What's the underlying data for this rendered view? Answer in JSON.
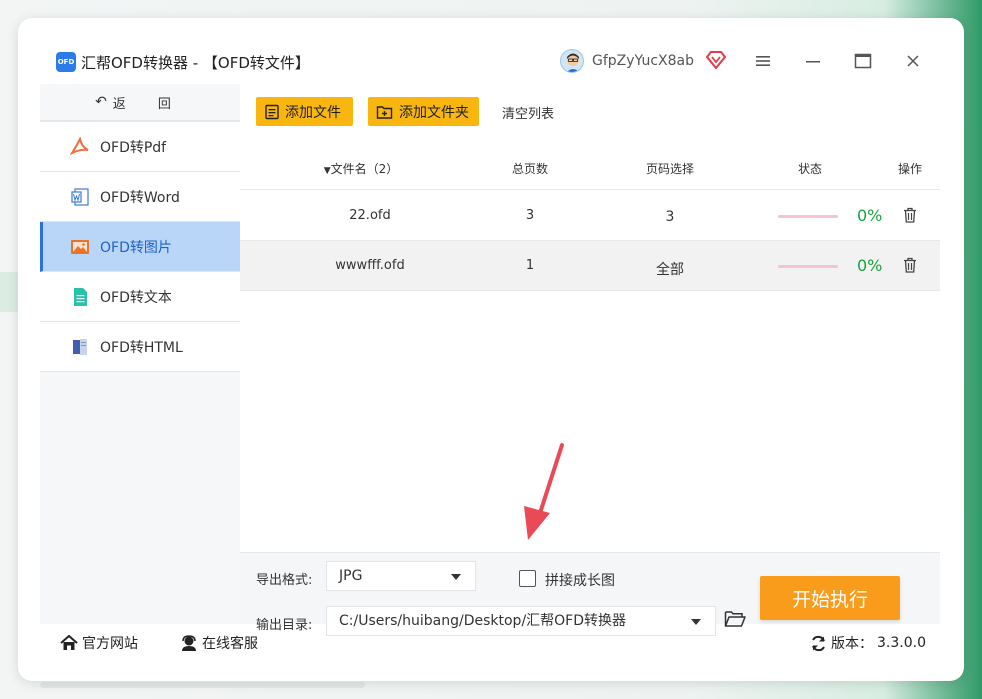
{
  "titlebar": {
    "logo_text": "OFD",
    "title": "汇帮OFD转换器 - 【OFD转文件】",
    "username": "GfpZyYucX8ab"
  },
  "sidebar": {
    "back_label": "返 回",
    "items": [
      {
        "label": "OFD转Pdf",
        "icon": "pdf-icon",
        "color": "#f0703e"
      },
      {
        "label": "OFD转Word",
        "icon": "word-icon",
        "color": "#3b78d8"
      },
      {
        "label": "OFD转图片",
        "icon": "image-icon",
        "color": "#e8742b",
        "active": true
      },
      {
        "label": "OFD转文本",
        "icon": "text-icon",
        "color": "#28c2a8"
      },
      {
        "label": "OFD转HTML",
        "icon": "html-icon",
        "color": "#3f5fb0"
      }
    ]
  },
  "toolbar": {
    "add_file": "添加文件",
    "add_folder": "添加文件夹",
    "clear_list": "清空列表"
  },
  "table": {
    "headers": {
      "filename": "文件名（2）",
      "pages": "总页数",
      "page_select": "页码选择",
      "status": "状态",
      "action": "操作"
    },
    "rows": [
      {
        "filename": "22.ofd",
        "pages": "3",
        "page_select": "3",
        "progress": 0,
        "progress_text": "0%"
      },
      {
        "filename": "wwwfff.ofd",
        "pages": "1",
        "page_select": "全部",
        "progress": 0,
        "progress_text": "0%"
      }
    ]
  },
  "export": {
    "format_label": "导出格式:",
    "format_value": "JPG",
    "merge_label": "拼接成长图",
    "merge_checked": false,
    "output_label": "输出目录:",
    "output_value": "C:/Users/huibang/Desktop/汇帮OFD转换器",
    "start_button": "开始执行"
  },
  "footer": {
    "website": "官方网站",
    "support": "在线客服",
    "version_label": "版本：",
    "version_value": "3.3.0.0"
  },
  "colors": {
    "accent": "#f8b60e",
    "start": "#f99b1b",
    "active_bg": "#b9d5f7",
    "progress_text": "#1aa33a",
    "annotation_arrow": "#e94a55"
  }
}
